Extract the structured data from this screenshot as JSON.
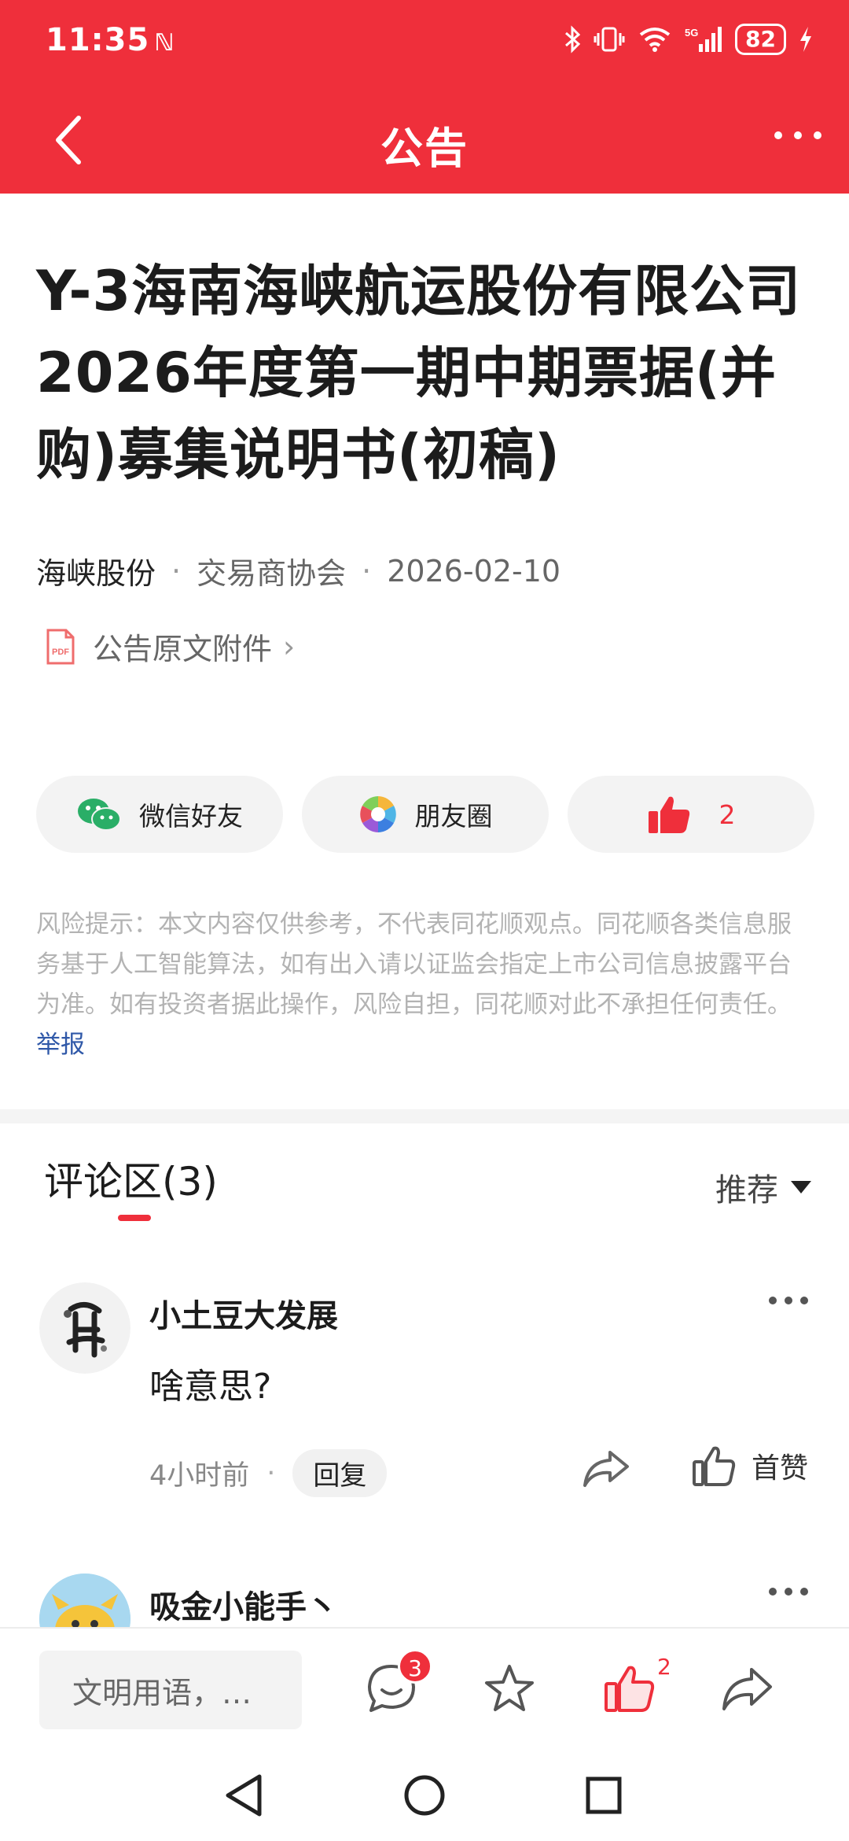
{
  "status_bar": {
    "time": "11:35",
    "nfc_icon": "nfc-icon",
    "battery": "82",
    "network": "5G"
  },
  "navbar": {
    "title": "公告",
    "back_icon": "back-chevron-icon",
    "more_icon": "more-dots-icon"
  },
  "article": {
    "title": "Y-3海南海峡航运股份有限公司2026年度第一期中期票据(并购)募集说明书(初稿)",
    "source": "海峡股份",
    "channel": "交易商协会",
    "date": "2026-02-10",
    "attachment_label": "公告原文附件",
    "attachment_chevron": "›"
  },
  "share": {
    "wechat_label": "微信好友",
    "moments_label": "朋友圈",
    "like_count": "2"
  },
  "risk": {
    "text": "风险提示：本文内容仅供参考，不代表同花顺观点。同花顺各类信息服务基于人工智能算法，如有出入请以证监会指定上市公司信息披露平台为准。如有投资者据此操作，风险自担，同花顺对此不承担任何责任。",
    "report_label": "举报"
  },
  "comments": {
    "title": "评论区(3)",
    "sort_label": "推荐",
    "items": [
      {
        "name": "小土豆大发展",
        "text": "啥意思?",
        "time": "4小时前",
        "reply_label": "回复",
        "like_label": "首赞"
      },
      {
        "name": "吸金小能手丶"
      }
    ]
  },
  "bottom_bar": {
    "input_placeholder": "文明用语，…",
    "comment_badge": "3",
    "like_count": "2"
  },
  "colors": {
    "brand_red": "#ef2f3b",
    "link_blue": "#2f58a8"
  }
}
